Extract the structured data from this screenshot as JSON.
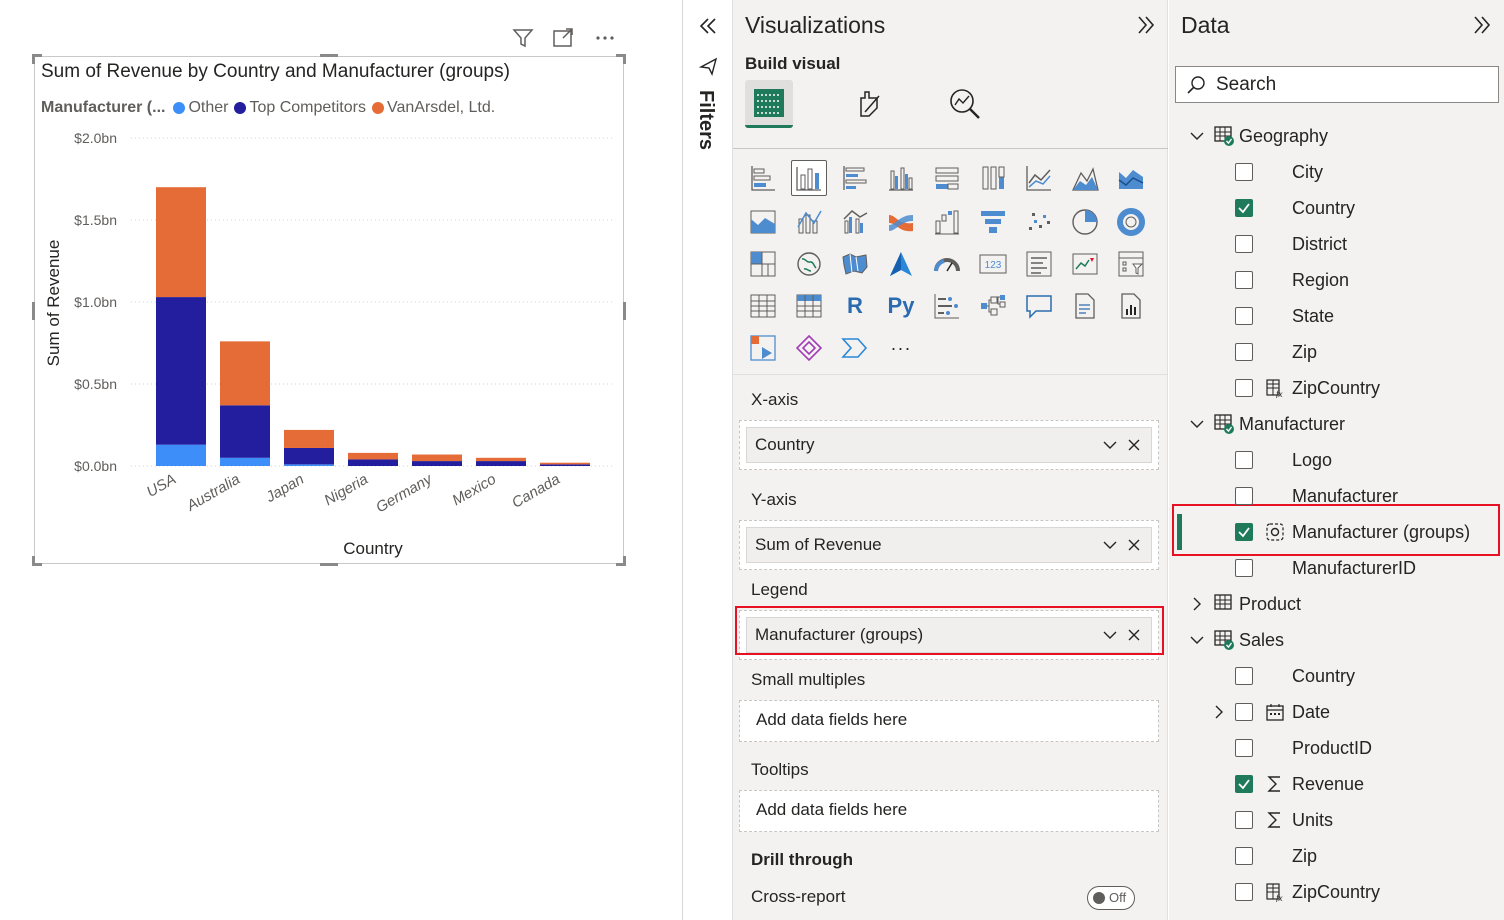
{
  "chart_data": {
    "type": "bar",
    "stacked": true,
    "title": "Sum of Revenue by Country and Manufacturer (groups)",
    "legend_title": "Manufacturer (...",
    "xlabel": "Country",
    "ylabel": "Sum of Revenue",
    "categories": [
      "USA",
      "Australia",
      "Japan",
      "Nigeria",
      "Germany",
      "Mexico",
      "Canada"
    ],
    "yticks": [
      "$0.0bn",
      "$0.5bn",
      "$1.0bn",
      "$1.5bn",
      "$2.0bn"
    ],
    "ylim": [
      0,
      2.0
    ],
    "series": [
      {
        "name": "Other",
        "color": "#3d8ef8",
        "values": [
          0.13,
          0.05,
          0.01,
          0.0,
          0.0,
          0.0,
          0.0
        ]
      },
      {
        "name": "Top Competitors",
        "color": "#221e9e",
        "values": [
          0.9,
          0.32,
          0.1,
          0.04,
          0.03,
          0.03,
          0.01
        ]
      },
      {
        "name": "VanArsdel, Ltd.",
        "color": "#e66c37",
        "values": [
          0.67,
          0.39,
          0.11,
          0.04,
          0.04,
          0.02,
          0.01
        ]
      }
    ],
    "grid": true,
    "legend_position": "top-left"
  },
  "filters": {
    "label": "Filters"
  },
  "viz": {
    "title": "Visualizations",
    "build_visual": "Build visual",
    "wells": {
      "x_axis": {
        "label": "X-axis",
        "field": "Country"
      },
      "y_axis": {
        "label": "Y-axis",
        "field": "Sum of Revenue"
      },
      "legend": {
        "label": "Legend",
        "field": "Manufacturer (groups)"
      },
      "small_multiples": {
        "label": "Small multiples",
        "placeholder": "Add data fields here"
      },
      "tooltips": {
        "label": "Tooltips",
        "placeholder": "Add data fields here"
      }
    },
    "drill_through": "Drill through",
    "cross_report": "Cross-report",
    "toggle": "Off",
    "more": "···",
    "r_label": "R",
    "py_label": "Py"
  },
  "data": {
    "title": "Data",
    "search_placeholder": "Search",
    "tables": [
      {
        "name": "Geography",
        "expanded": true,
        "fields": [
          {
            "name": "City",
            "checked": false,
            "icon": ""
          },
          {
            "name": "Country",
            "checked": true,
            "icon": ""
          },
          {
            "name": "District",
            "checked": false,
            "icon": ""
          },
          {
            "name": "Region",
            "checked": false,
            "icon": ""
          },
          {
            "name": "State",
            "checked": false,
            "icon": ""
          },
          {
            "name": "Zip",
            "checked": false,
            "icon": ""
          },
          {
            "name": "ZipCountry",
            "checked": false,
            "icon": "calc-column-icon"
          }
        ]
      },
      {
        "name": "Manufacturer",
        "expanded": true,
        "fields": [
          {
            "name": "Logo",
            "checked": false,
            "icon": ""
          },
          {
            "name": "Manufacturer",
            "checked": false,
            "icon": ""
          },
          {
            "name": "Manufacturer (groups)",
            "checked": true,
            "icon": "group-icon"
          },
          {
            "name": "ManufacturerID",
            "checked": false,
            "icon": ""
          }
        ]
      },
      {
        "name": "Product",
        "expanded": false,
        "fields": []
      },
      {
        "name": "Sales",
        "expanded": true,
        "fields": [
          {
            "name": "Country",
            "checked": false,
            "icon": ""
          },
          {
            "name": "Date",
            "checked": false,
            "icon": "calendar-icon"
          },
          {
            "name": "ProductID",
            "checked": false,
            "icon": ""
          },
          {
            "name": "Revenue",
            "checked": true,
            "icon": "sigma-icon"
          },
          {
            "name": "Units",
            "checked": false,
            "icon": "sigma-icon"
          },
          {
            "name": "Zip",
            "checked": false,
            "icon": ""
          },
          {
            "name": "ZipCountry",
            "checked": false,
            "icon": "calc-column-icon"
          }
        ]
      }
    ]
  }
}
